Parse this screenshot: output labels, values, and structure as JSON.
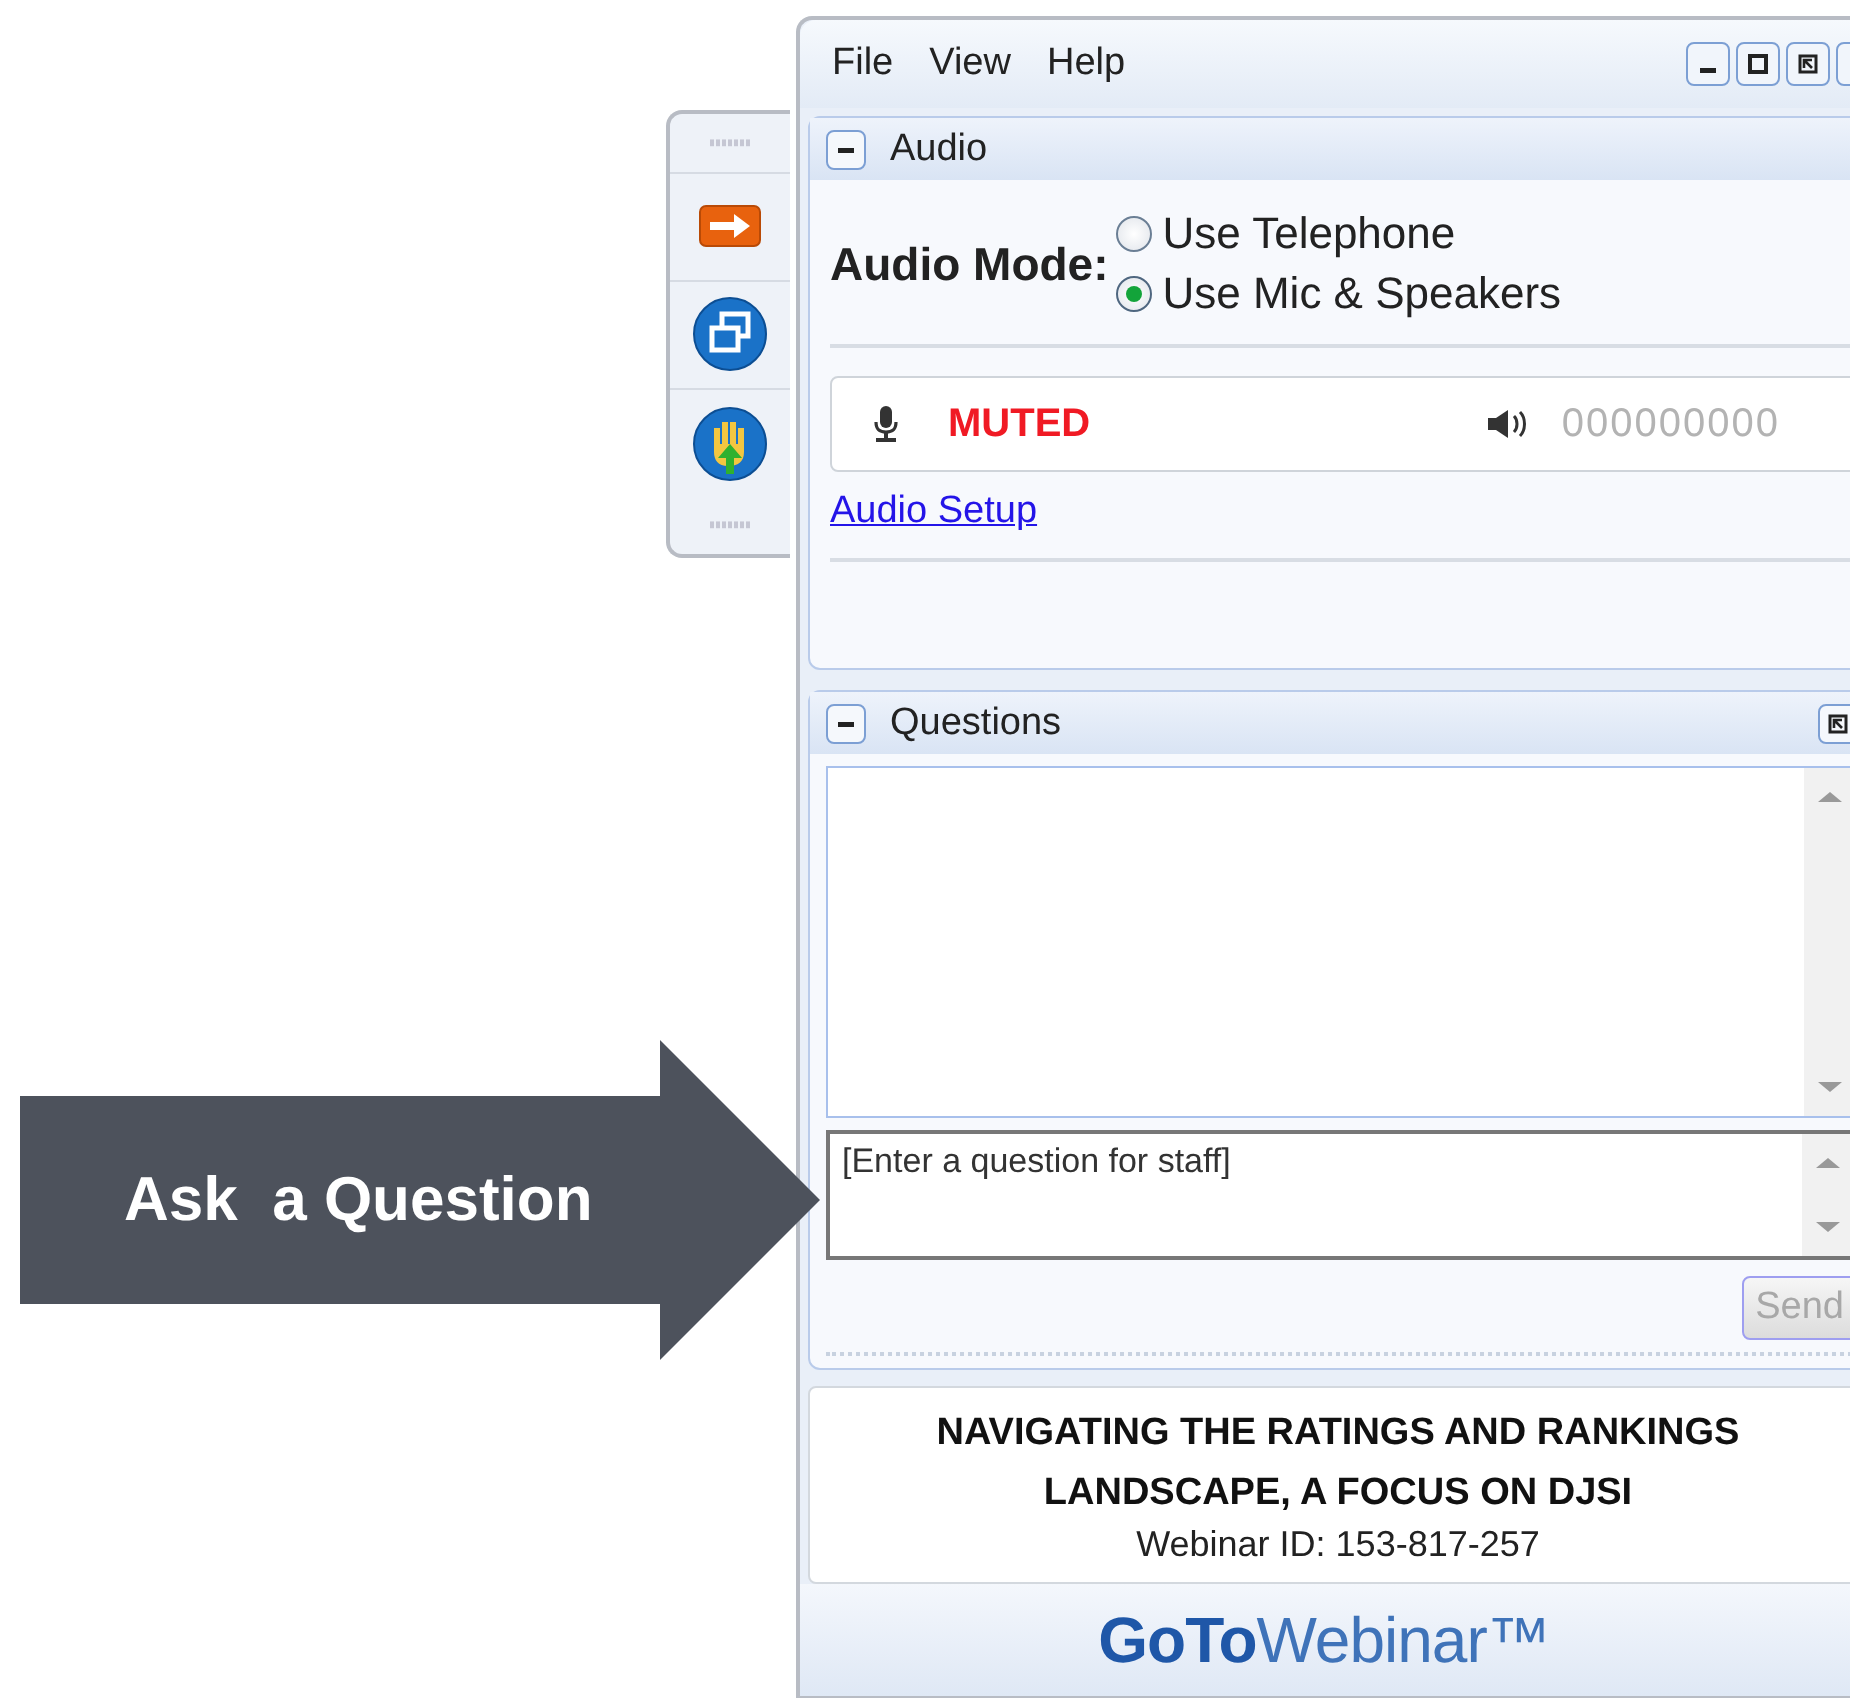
{
  "callout": {
    "label": "Ask  a Question"
  },
  "menu": [
    "File",
    "View",
    "Help"
  ],
  "audio": {
    "title": "Audio",
    "expanded": true,
    "mode_label": "Audio Mode:",
    "options": [
      {
        "label": "Use Telephone",
        "selected": false
      },
      {
        "label": "Use Mic & Speakers",
        "selected": true
      }
    ],
    "mic_status": "MUTED",
    "speaker_level_text": "000000000",
    "setup_link": "Audio Setup"
  },
  "questions": {
    "title": "Questions",
    "expanded": true,
    "input_placeholder": "[Enter a question for staff]",
    "send": {
      "label": "Send",
      "disabled": true
    }
  },
  "webinar": {
    "title": "NAVIGATING THE RATINGS AND RANKINGS LANDSCAPE, A FOCUS ON DJSI",
    "id_text": "Webinar ID: 153-817-257"
  },
  "logo": "**GoTo**Webinar™"
}
